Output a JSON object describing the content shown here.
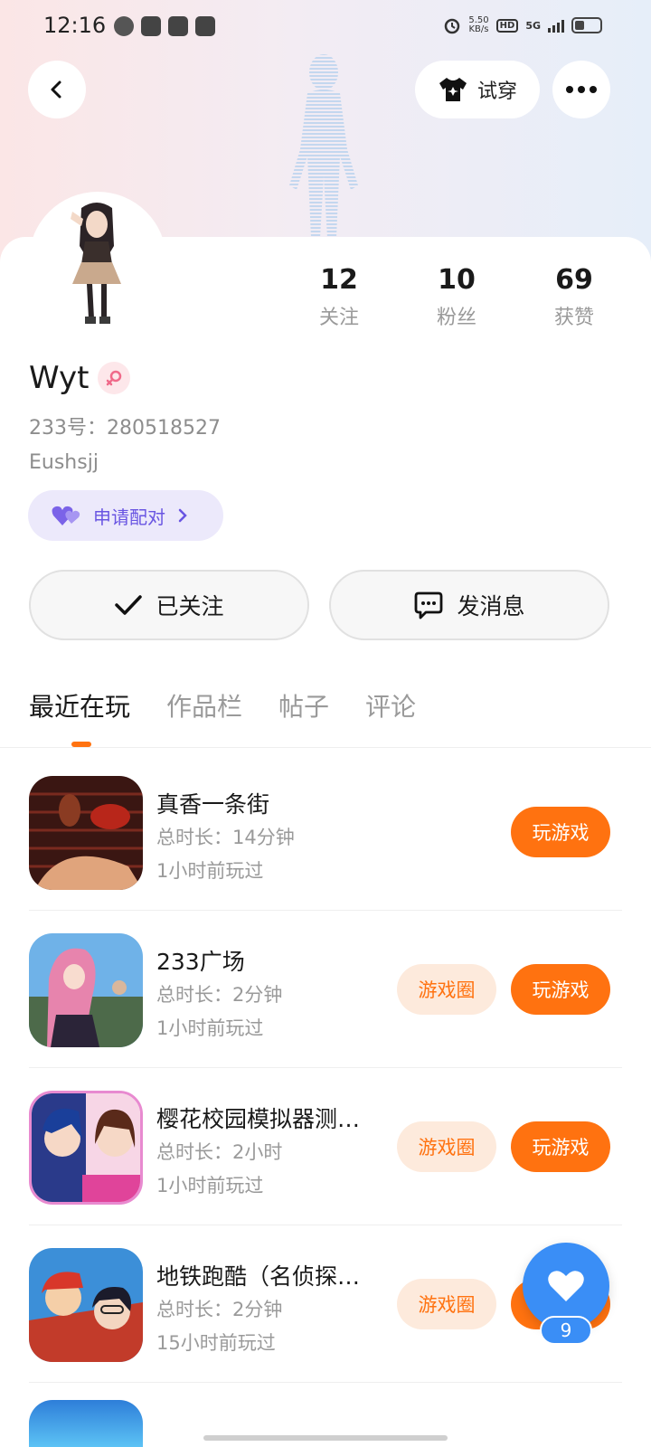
{
  "status_bar": {
    "time": "12:16",
    "net_speed": "5.50",
    "net_unit": "KB/s",
    "hd": "HD",
    "signal": "5G"
  },
  "header": {
    "try_on_label": "试穿"
  },
  "stats": [
    {
      "value": "12",
      "label": "关注"
    },
    {
      "value": "10",
      "label": "粉丝"
    },
    {
      "value": "69",
      "label": "获赞"
    }
  ],
  "profile": {
    "username": "Wyt",
    "uid": "233号：280518527",
    "bio": "Eushsjj",
    "pair_label": "申请配对"
  },
  "actions": {
    "follow_label": "已关注",
    "message_label": "发消息"
  },
  "tabs": [
    "最近在玩",
    "作品栏",
    "帖子",
    "评论"
  ],
  "games": [
    {
      "name": "真香一条街",
      "duration": "总时长：14分钟",
      "last_played": "1小时前玩过",
      "circle_label": "",
      "play_label": "玩游戏"
    },
    {
      "name": "233广场",
      "duration": "总时长：2分钟",
      "last_played": "1小时前玩过",
      "circle_label": "游戏圈",
      "play_label": "玩游戏"
    },
    {
      "name": "樱花校园模拟器测…",
      "duration": "总时长：2小时",
      "last_played": "1小时前玩过",
      "circle_label": "游戏圈",
      "play_label": "玩游戏"
    },
    {
      "name": "地铁跑酷（名侦探…",
      "duration": "总时长：2分钟",
      "last_played": "15小时前玩过",
      "circle_label": "游戏圈",
      "play_label": "玩游戏"
    }
  ],
  "like_fab": {
    "count": "9"
  },
  "colors": {
    "accent": "#ff7210",
    "pair": "#6955e2",
    "like": "#3a8ef6"
  }
}
